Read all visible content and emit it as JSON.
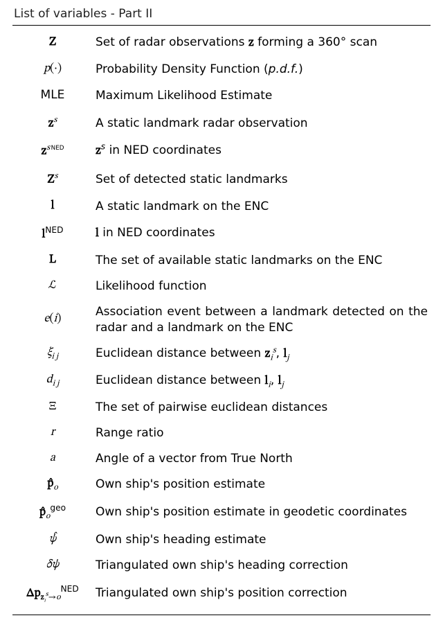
{
  "title": "List of variables - Part II",
  "rows": [
    {
      "symbol_html": "<span class='bf'>Z</span>",
      "desc_html": "Set of radar observations <span class='bf m'>z</span> forming a 360° scan"
    },
    {
      "symbol_html": "<span class='it'>p</span>(·)",
      "desc_html": "Probability Density Function (<span class='it'>p.d.f.</span>)"
    },
    {
      "symbol_html": "<span class='sf'>MLE</span>",
      "desc_html": "Maximum Likelihood Estimate"
    },
    {
      "symbol_html": "<span class='bf'>z</span><span class='sup it'>s</span>",
      "desc_html": "A static landmark radar observation"
    },
    {
      "symbol_html": "<span class='bf'>z</span><span class='sup'><span class='it'>s</span>&#8201;<span class='sfs'>NED</span></span>",
      "desc_html": "<span class='bf m'>z</span><sup class='it'>s</sup> in NED coordinates"
    },
    {
      "symbol_html": "<span class='bf'>Z</span><span class='sup it'>s</span>",
      "desc_html": "Set of detected static landmarks"
    },
    {
      "symbol_html": "<span class='bf'>l</span>",
      "desc_html": "A static landmark on the ENC"
    },
    {
      "symbol_html": "<span class='bf'>l</span><span class='sup sfs'>NED</span>",
      "desc_html": "<span class='bf m'>l</span> in NED coordinates"
    },
    {
      "symbol_html": "<span class='bf'>L</span>",
      "desc_html": "The set of available static landmarks on the ENC"
    },
    {
      "symbol_html": "<span class='rm'>&#8466;</span>",
      "desc_html": "Likelihood function"
    },
    {
      "symbol_html": "<span class='it'>e</span>(<span class='it'>i</span>)",
      "desc_html": "Association event between a landmark detected on the radar and a landmark on the ENC"
    },
    {
      "symbol_html": "<span class='it'>ξ</span><span class='sub it'>i j</span>",
      "desc_html": "Euclidean distance between <span class='bf m'>z</span><sub class='it m'>i</sub><sup class='it m'>s</sup>,&nbsp;<span class='bf m'>l</span><sub class='it m'>j</sub>"
    },
    {
      "symbol_html": "<span class='it'>d</span><span class='sub it'>i j</span>",
      "desc_html": "Euclidean distance between <span class='bf m'>l</span><sub class='it m'>i</sub>,&nbsp;<span class='bf m'>l</span><sub class='it m'>j</sub>"
    },
    {
      "symbol_html": "Ξ",
      "desc_html": "The set of pairwise euclidean distances"
    },
    {
      "symbol_html": "<span class='it'>r</span>",
      "desc_html": "Range ratio"
    },
    {
      "symbol_html": "<span class='it'>a</span>",
      "desc_html": "Angle of a vector from True North"
    },
    {
      "symbol_html": "<span class='bf'>p&#x0302;</span><span class='sub it'>o</span>",
      "desc_html": "Own ship's position estimate"
    },
    {
      "symbol_html": "<span class='bf'>p&#x0302;</span><span class='sub it'>o</span><span class='sup sfs'>geo</span>",
      "desc_html": "Own ship's position estimate in geodetic coordinates"
    },
    {
      "symbol_html": "<span class='it'>ψ&#x0302;</span>",
      "desc_html": "Own ship's heading estimate"
    },
    {
      "symbol_html": "<span class='it'>δψ</span>",
      "desc_html": "Triangulated own ship's heading correction"
    },
    {
      "symbol_html": "<span class='bf'>Δp</span><span class='sub'><span class='bf' style='font-size:0.9em'>z</span><span class='subsub it'>i</span><span class='it' style='font-size:0.8em;vertical-align:super'>s</span>→<span class='it'>o</span></span><span class='sup sfs'>NED</span>",
      "desc_html": "Triangulated own ship's position correction"
    }
  ]
}
